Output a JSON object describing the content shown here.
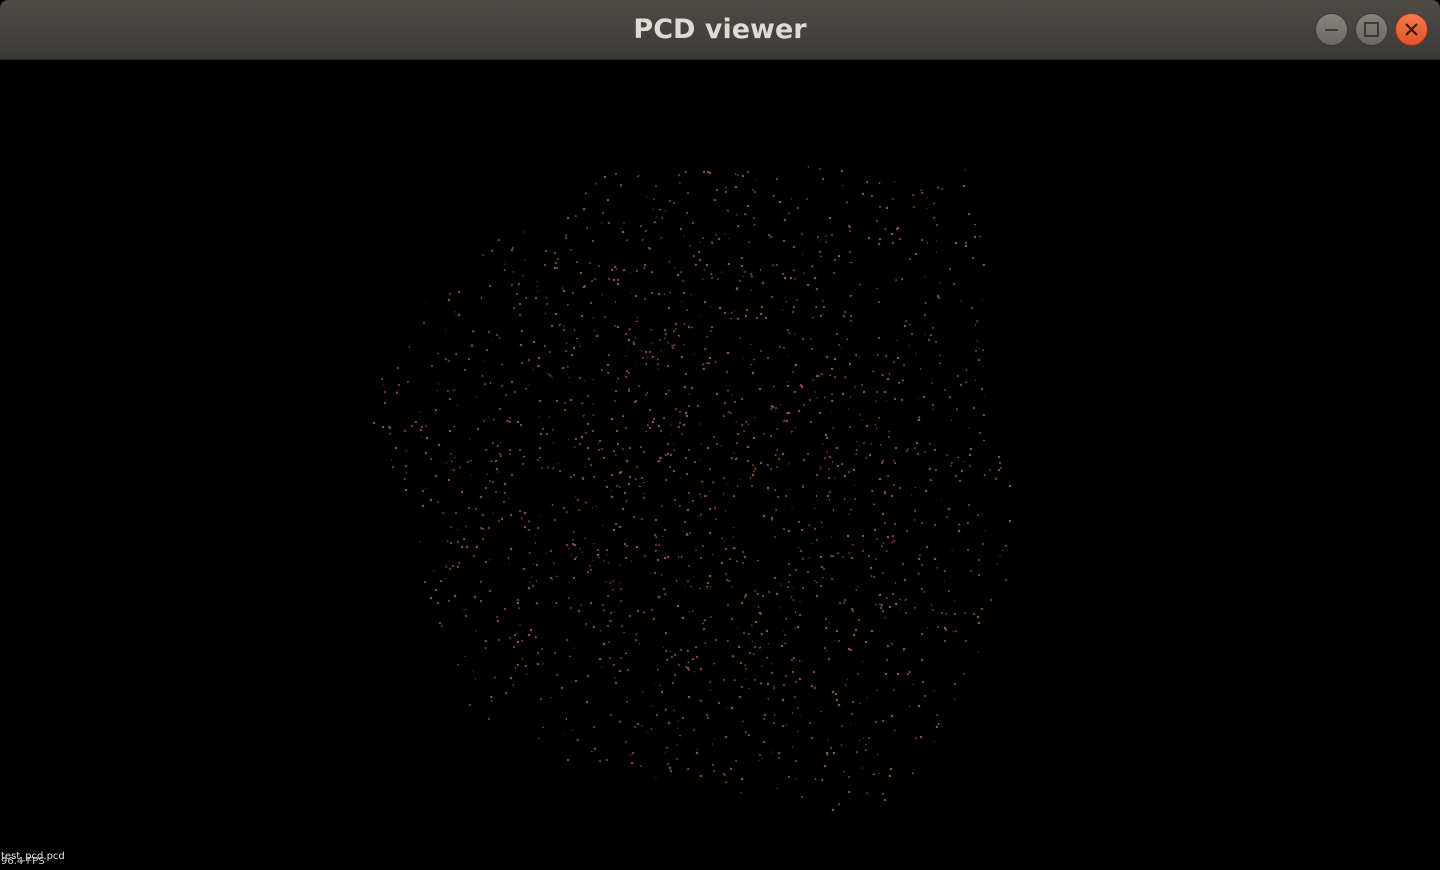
{
  "window": {
    "title": "PCD viewer",
    "controls": {
      "minimize": "minimize-icon",
      "maximize": "maximize-icon",
      "close": "close-icon"
    },
    "colors": {
      "titlebar": "#3c3b37",
      "title_text": "#dfdbd2",
      "close_button": "#e95420"
    }
  },
  "viewer": {
    "background_color": "#000000",
    "point_color": "#b47868",
    "overlay": {
      "file_name": "test_pcd.pcd",
      "fps": "96.4 FPS"
    }
  }
}
